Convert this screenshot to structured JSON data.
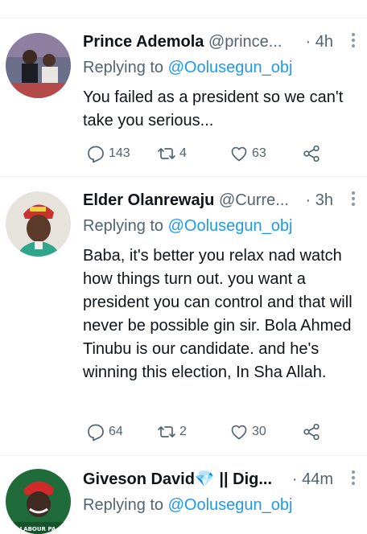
{
  "tweets": [
    {
      "name": "Prince Ademola",
      "handle": "@prince...",
      "dot": "·",
      "time": "4h",
      "reply_prefix": "Replying to ",
      "reply_to": "@Oolusegun_obj",
      "text": "You failed as a president so we can't take you serious...",
      "replies": "143",
      "retweets": "4",
      "likes": "63"
    },
    {
      "name": "Elder Olanrewaju",
      "handle": "@Curre...",
      "dot": "·",
      "time": "3h",
      "reply_prefix": "Replying to ",
      "reply_to": "@Oolusegun_obj",
      "text": "Baba, it's better you relax nad watch how things turn out. you want a president you can control and that will never be possible gin sir. Bola Ahmed Tinubu is our candidate. and he's winning this election, In Sha Allah.",
      "replies": "64",
      "retweets": "2",
      "likes": "30"
    },
    {
      "name": "Giveson David💎 || Dig...",
      "handle": "",
      "dot": "·",
      "time": "44m",
      "reply_prefix": "Replying to ",
      "reply_to": "@Oolusegun_obj",
      "avatar_caption": "LABOUR PA"
    }
  ],
  "colors": {
    "accent": "#1d9bf0",
    "muted": "#536471",
    "divider": "#eff3f4"
  }
}
